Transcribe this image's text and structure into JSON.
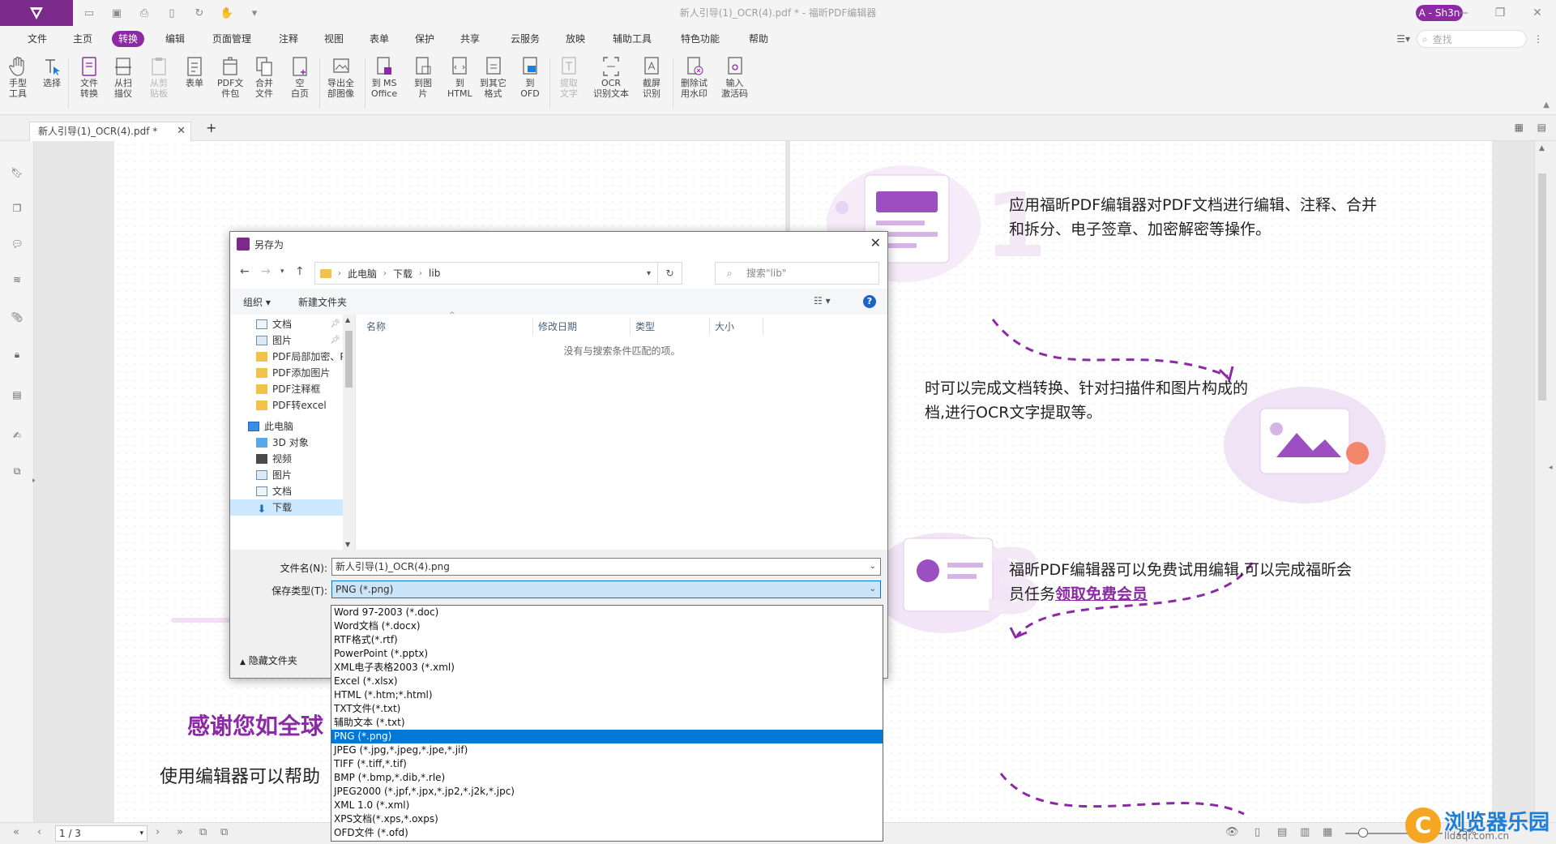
{
  "titlebar": {
    "doc_title": "新人引导(1)_OCR(4).pdf * - 福昕PDF编辑器",
    "user_badge": "A - Sh3n"
  },
  "menu": {
    "items": [
      "文件",
      "主页",
      "转换",
      "编辑",
      "页面管理",
      "注释",
      "视图",
      "表单",
      "保护",
      "共享",
      "云服务",
      "放映",
      "辅助工具",
      "特色功能",
      "帮助"
    ],
    "active": "转换",
    "search_placeholder": "查找"
  },
  "ribbon": {
    "buttons": [
      {
        "label": "手型\n工具",
        "icon": "hand-icon"
      },
      {
        "label": "选择",
        "icon": "select-icon"
      },
      {
        "label": "文件\n转换",
        "icon": "file-convert-icon"
      },
      {
        "label": "从扫\n描仪",
        "icon": "scanner-icon"
      },
      {
        "label": "从剪\n贴板",
        "icon": "clipboard-icon"
      },
      {
        "label": "表单",
        "icon": "form-icon"
      },
      {
        "label": "PDF文\n件包",
        "icon": "pdf-package-icon"
      },
      {
        "label": "合并\n文件",
        "icon": "merge-icon"
      },
      {
        "label": "空\n白页",
        "icon": "blank-page-icon"
      },
      {
        "label": "导出全\n部图像",
        "icon": "export-images-icon"
      },
      {
        "label": "到 MS\nOffice",
        "icon": "to-office-icon"
      },
      {
        "label": "到图\n片",
        "icon": "to-image-icon"
      },
      {
        "label": "到\nHTML",
        "icon": "to-html-icon"
      },
      {
        "label": "到其它\n格式",
        "icon": "to-other-icon"
      },
      {
        "label": "到\nOFD",
        "icon": "to-ofd-icon"
      },
      {
        "label": "提取\n文字",
        "icon": "extract-text-icon"
      },
      {
        "label": "OCR\n识别文本",
        "icon": "ocr-icon"
      },
      {
        "label": "截屏\n识别",
        "icon": "screenshot-ocr-icon"
      },
      {
        "label": "删除试\n用水印",
        "icon": "remove-watermark-icon"
      },
      {
        "label": "输入\n激活码",
        "icon": "activation-icon"
      }
    ]
  },
  "tab": {
    "label": "新人引导(1)_OCR(4).pdf *"
  },
  "document": {
    "step1_num": "1",
    "step1_text_line1": "应用福昕PDF编辑器对PDF文档进行编辑、注释、合并",
    "step1_text_line2": "和拆分、电子签章、加密解密等操作。",
    "step2_text_line1": "时可以完成文档转换、针对扫描件和图片构成的",
    "step2_text_line2": "档,进行OCR文字提取等。",
    "step3_num": "3",
    "step3_text_line1": "福昕PDF编辑器可以免费试用编辑,可以完成福昕会",
    "step3_text_line2": "员任务",
    "step3_link": "领取免费会员",
    "thanks_heading": "感谢您如全球",
    "body_line": "使用编辑器可以帮助",
    "colors": {
      "accent": "#8c2aa6",
      "link": "#8c2aa6",
      "step_num": "#f3e8f6"
    }
  },
  "statusbar": {
    "page_indicator": "1 / 3",
    "zoom": "25%"
  },
  "watermark": {
    "brand": "浏览器乐园",
    "url": "lldaqi.com.cn"
  },
  "dialog": {
    "title": "另存为",
    "breadcrumb": [
      "此电脑",
      "下载",
      "lib"
    ],
    "search_placeholder": "搜索\"lib\"",
    "toolbar": {
      "organize": "组织 ▾",
      "new_folder": "新建文件夹"
    },
    "tree": [
      {
        "label": "文档",
        "icon": "documents-icon",
        "pinned": true
      },
      {
        "label": "图片",
        "icon": "pictures-icon",
        "pinned": true
      },
      {
        "label": "PDF局部加密、PD",
        "icon": "folder-icon",
        "pinned": false
      },
      {
        "label": "PDF添加图片",
        "icon": "folder-icon",
        "pinned": false
      },
      {
        "label": "PDF注释框",
        "icon": "folder-icon",
        "pinned": false
      },
      {
        "label": "PDF转excel",
        "icon": "folder-icon",
        "pinned": false
      },
      {
        "label": "此电脑",
        "icon": "computer-icon",
        "pinned": false
      },
      {
        "label": "3D 对象",
        "icon": "3d-icon",
        "pinned": false
      },
      {
        "label": "视频",
        "icon": "video-icon",
        "pinned": false
      },
      {
        "label": "图片",
        "icon": "pictures-icon",
        "pinned": false
      },
      {
        "label": "文档",
        "icon": "documents-icon",
        "pinned": false
      },
      {
        "label": "下载",
        "icon": "download-icon",
        "pinned": false
      }
    ],
    "columns": [
      "名称",
      "修改日期",
      "类型",
      "大小"
    ],
    "empty_message": "没有与搜索条件匹配的项。",
    "filename_label": "文件名(N):",
    "filename_value": "新人引导(1)_OCR(4).png",
    "filetype_label": "保存类型(T):",
    "filetype_value": "PNG (*.png)",
    "hide_folders": "隐藏文件夹",
    "filetype_options": [
      "Word 97-2003 (*.doc)",
      "Word文档 (*.docx)",
      "RTF格式(*.rtf)",
      "PowerPoint (*.pptx)",
      "XML电子表格2003 (*.xml)",
      "Excel (*.xlsx)",
      "HTML (*.htm;*.html)",
      "TXT文件(*.txt)",
      "辅助文本 (*.txt)",
      "PNG (*.png)",
      "JPEG (*.jpg,*.jpeg,*.jpe,*.jif)",
      "TIFF (*.tiff,*.tif)",
      "BMP (*.bmp,*.dib,*.rle)",
      "JPEG2000 (*.jpf,*.jpx,*.jp2,*.j2k,*.jpc)",
      "XML 1.0 (*.xml)",
      "XPS文档(*.xps,*.oxps)",
      "OFD文件 (*.ofd)"
    ],
    "selected_option_index": 9
  }
}
